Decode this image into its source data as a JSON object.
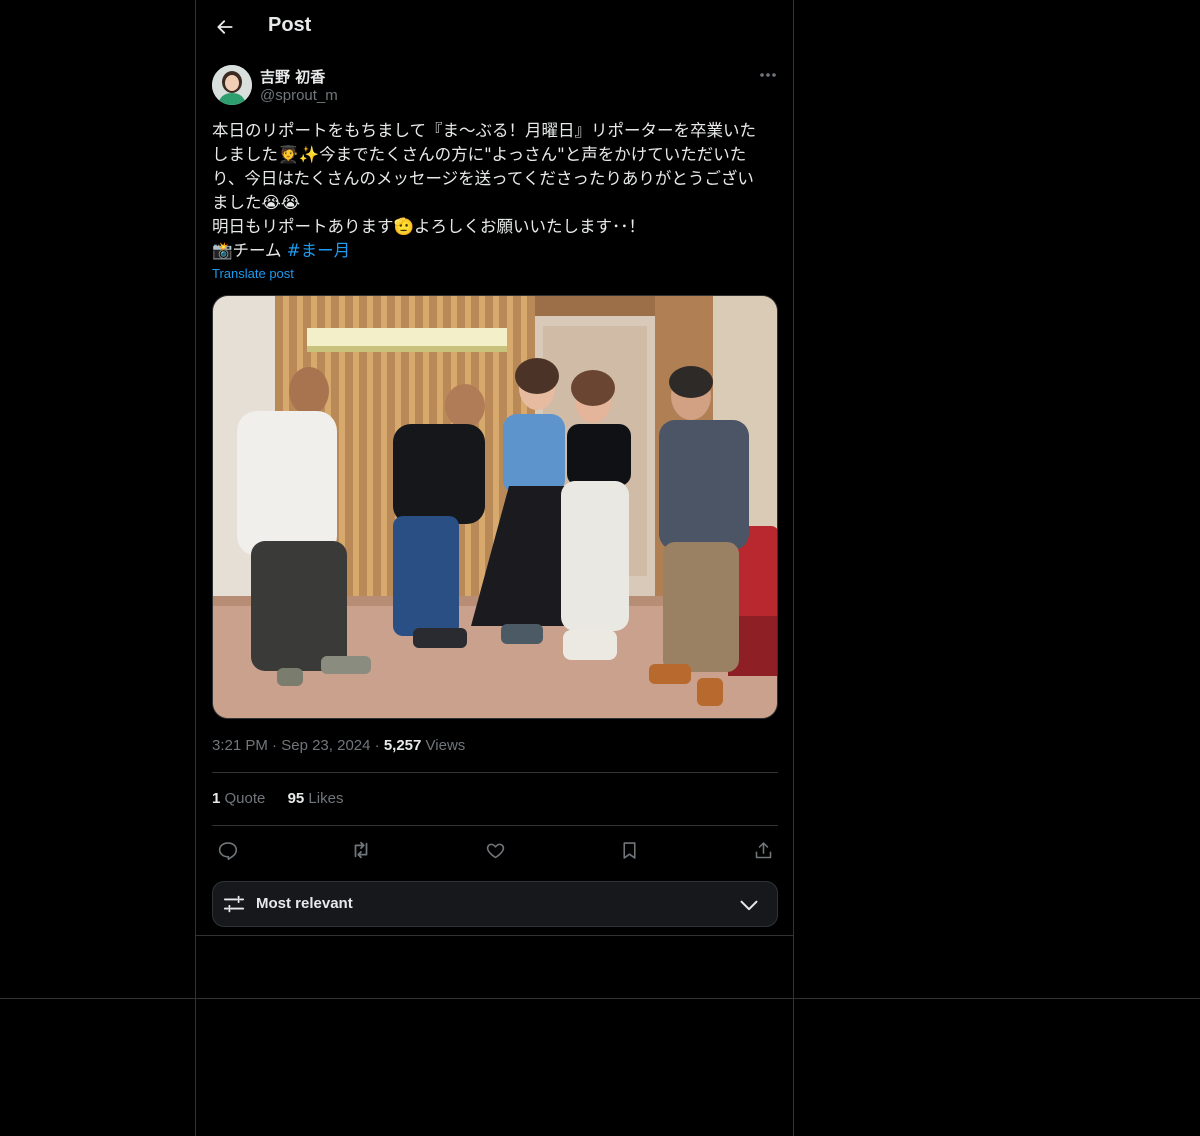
{
  "header": {
    "title": "Post",
    "back_icon": "arrow-left-icon"
  },
  "author": {
    "name": "吉野 初香",
    "handle": "@sprout_m",
    "more_icon": "more-horizontal-icon"
  },
  "tweet": {
    "lines": [
      "本日のリポートをもちまして『ま〜ぶる！月曜日』リポーターを卒業いた",
      "しました🧑‍🎓✨今までたくさんの方に\"よっさん\"と声をかけていただいた",
      "り、今日はたくさんのメッセージを送ってくださったりありがとうござい",
      "ました😭😭",
      "明日もリポートあります🫡よろしくお願いいたします･･！"
    ],
    "last_line_prefix": "📸チーム ",
    "hashtag": "#まー月",
    "translate": "Translate post"
  },
  "meta": {
    "time": "3:21 PM",
    "date": "Sep 23, 2024",
    "views_count": "5,257",
    "views_label": "Views"
  },
  "stats": {
    "quotes_count": "1",
    "quotes_label": "Quote",
    "likes_count": "95",
    "likes_label": "Likes"
  },
  "actions": [
    "reply-icon",
    "retweet-icon",
    "like-icon",
    "bookmark-icon",
    "share-icon"
  ],
  "sort": {
    "label": "Most relevant",
    "icon": "sliders-icon",
    "chevron": "chevron-down-icon"
  },
  "colors": {
    "background": "#000000",
    "border": "#2f3336",
    "text": "#e7e9ea",
    "muted": "#71767b",
    "link": "#1d9bf0"
  }
}
